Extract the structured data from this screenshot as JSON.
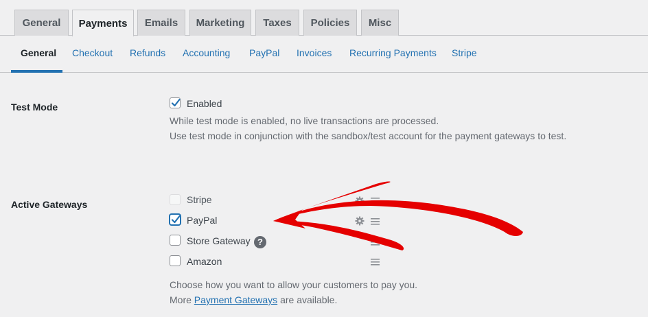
{
  "tabs": [
    {
      "label": "General",
      "active": false
    },
    {
      "label": "Payments",
      "active": true
    },
    {
      "label": "Emails",
      "active": false
    },
    {
      "label": "Marketing",
      "active": false
    },
    {
      "label": "Taxes",
      "active": false
    },
    {
      "label": "Policies",
      "active": false
    },
    {
      "label": "Misc",
      "active": false
    }
  ],
  "subtabs": [
    {
      "label": "General",
      "active": true
    },
    {
      "label": "Checkout",
      "active": false
    },
    {
      "label": "Refunds",
      "active": false
    },
    {
      "label": "Accounting",
      "active": false
    },
    {
      "label": "PayPal",
      "active": false
    },
    {
      "label": "Invoices",
      "active": false
    },
    {
      "label": "Recurring Payments",
      "active": false
    },
    {
      "label": "Stripe",
      "active": false
    }
  ],
  "test_mode": {
    "label": "Test Mode",
    "checkbox_label": "Enabled",
    "checked": true,
    "desc_line1": "While test mode is enabled, no live transactions are processed.",
    "desc_line2": "Use test mode in conjunction with the sandbox/test account for the payment gateways to test."
  },
  "gateways": {
    "label": "Active Gateways",
    "items": [
      {
        "label": "Stripe",
        "checked": false
      },
      {
        "label": "PayPal",
        "checked": true
      },
      {
        "label": "Store Gateway",
        "checked": false
      },
      {
        "label": "Amazon",
        "checked": false
      }
    ],
    "desc_line1": "Choose how you want to allow your customers to pay you.",
    "desc_more_prefix": "More ",
    "desc_more_link": "Payment Gateways",
    "desc_more_suffix": " are available."
  },
  "colors": {
    "accent": "#2271b1",
    "annotation_arrow": "#e50000"
  }
}
